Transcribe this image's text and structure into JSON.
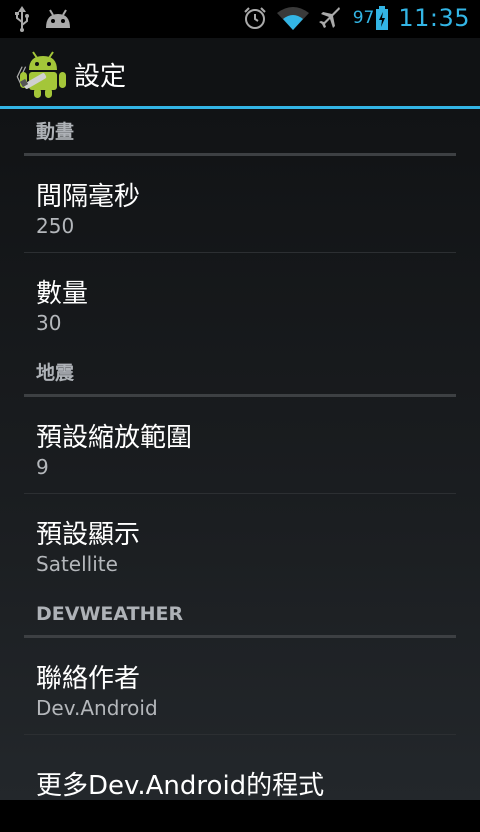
{
  "status_bar": {
    "left_icons": [
      "usb-icon",
      "android-debug-icon"
    ],
    "right_icons": [
      "alarm-icon",
      "wifi-icon",
      "airplane-mode-icon",
      "battery-charging-icon"
    ],
    "battery_level": "97",
    "time": "11:35",
    "accent_color": "#33b5e5"
  },
  "action_bar": {
    "title": "設定",
    "back_icon": "chevron-left-icon",
    "app_icon": "android-app-icon"
  },
  "preferences": {
    "category_animation": {
      "title": "動畫",
      "interval": {
        "title": "間隔毫秒",
        "summary": "250"
      },
      "count": {
        "title": "數量",
        "summary": "30"
      }
    },
    "category_earthquake": {
      "title": "地震",
      "default_zoom": {
        "title": "預設縮放範圍",
        "summary": "9"
      },
      "default_display": {
        "title": "預設顯示",
        "summary": "Satellite"
      }
    },
    "category_devweather": {
      "title": "DEVWEATHER",
      "contact_author": {
        "title": "聯絡作者",
        "summary": "Dev.Android"
      },
      "more_apps": {
        "title": "更多Dev.Android的程式"
      }
    }
  }
}
